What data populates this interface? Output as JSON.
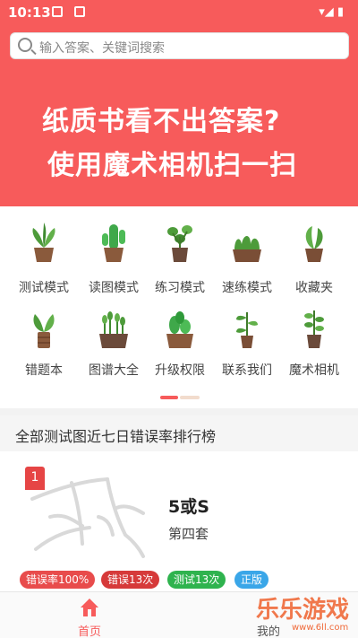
{
  "status_bar": {
    "time": "10:13"
  },
  "search": {
    "placeholder": "输入答案、关键词搜索"
  },
  "banner": {
    "line1": "纸质书看不出答案?",
    "line2": "使用魔术相机扫一扫"
  },
  "menu": [
    {
      "label": "测试模式",
      "icon": "plant-icon"
    },
    {
      "label": "读图模式",
      "icon": "cactus-icon"
    },
    {
      "label": "练习模式",
      "icon": "plant-icon"
    },
    {
      "label": "速练模式",
      "icon": "plant-icon"
    },
    {
      "label": "收藏夹",
      "icon": "plant-icon"
    },
    {
      "label": "错题本",
      "icon": "plant-icon"
    },
    {
      "label": "图谱大全",
      "icon": "plant-icon"
    },
    {
      "label": "升级权限",
      "icon": "cactus-icon"
    },
    {
      "label": "联系我们",
      "icon": "plant-icon"
    },
    {
      "label": "魔术相机",
      "icon": "plant-icon"
    }
  ],
  "ranking": {
    "title": "全部测试图近七日错误率排行榜",
    "items": [
      {
        "rank": "1",
        "answer": "5或S",
        "set": "第四套",
        "tags": [
          {
            "text": "错误率100%",
            "color": "#e84c4c"
          },
          {
            "text": "错误13次",
            "color": "#d63a3a"
          },
          {
            "text": "测试13次",
            "color": "#2fb34e"
          },
          {
            "text": "正版",
            "color": "#3aa6e8"
          }
        ]
      }
    ]
  },
  "tabbar": {
    "home": "首页",
    "mine": "我的"
  },
  "watermark": {
    "text": "乐乐游戏",
    "url": "www.6ll.com"
  },
  "colors": {
    "accent": "#f75b5b"
  }
}
